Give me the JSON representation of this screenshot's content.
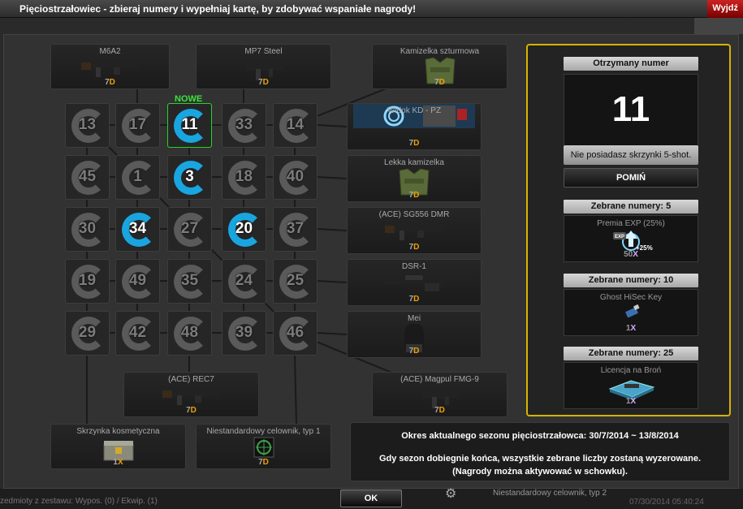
{
  "window": {
    "title": "Pięciostrzałowiec - zbieraj numery i wypełniaj kartę, by zdobywać wspaniałe nagrody!",
    "exit_label": "Wyjdź"
  },
  "prizes": {
    "top": [
      {
        "name": "M6A2",
        "qty": "7",
        "unit": "D",
        "icon": "rifle-icon"
      },
      {
        "name": "MP7 Steel",
        "qty": "7",
        "unit": "D",
        "icon": "smg-icon"
      },
      {
        "name": "Kamizelka szturmowa",
        "qty": "7",
        "unit": "D",
        "icon": "vest-icon"
      }
    ],
    "right": [
      {
        "name": "Widok KD - PZ",
        "qty": "7",
        "unit": "D",
        "icon": "scope-view-icon"
      },
      {
        "name": "Lekka kamizelka",
        "qty": "7",
        "unit": "D",
        "icon": "vest-icon"
      },
      {
        "name": "(ACE) SG556 DMR",
        "qty": "7",
        "unit": "D",
        "icon": "rifle-icon"
      },
      {
        "name": "DSR-1",
        "qty": "7",
        "unit": "D",
        "icon": "sniper-icon"
      },
      {
        "name": "Mei",
        "qty": "7",
        "unit": "D",
        "icon": "character-icon"
      }
    ],
    "bottom": [
      {
        "name": "(ACE) REC7",
        "qty": "7",
        "unit": "D",
        "icon": "rifle-icon"
      },
      {
        "name": "(ACE) Magpul FMG-9",
        "qty": "7",
        "unit": "D",
        "icon": "smg-icon"
      }
    ],
    "corner": [
      {
        "name": "Skrzynka kosmetyczna",
        "qty": "1",
        "unit": "X",
        "icon": "crate-icon"
      },
      {
        "name": "Niestandardowy celownik, typ 1",
        "qty": "7",
        "unit": "D",
        "icon": "crosshair-icon"
      }
    ]
  },
  "grid": {
    "newest_label": "NOWE",
    "rows": [
      [
        {
          "n": "13",
          "hit": false
        },
        {
          "n": "17",
          "hit": false
        },
        {
          "n": "11",
          "hit": true,
          "newest": true
        },
        {
          "n": "33",
          "hit": false
        },
        {
          "n": "14",
          "hit": false
        }
      ],
      [
        {
          "n": "45",
          "hit": false
        },
        {
          "n": "1",
          "hit": false
        },
        {
          "n": "3",
          "hit": true
        },
        {
          "n": "18",
          "hit": false
        },
        {
          "n": "40",
          "hit": false
        }
      ],
      [
        {
          "n": "30",
          "hit": false
        },
        {
          "n": "34",
          "hit": true
        },
        {
          "n": "27",
          "hit": false
        },
        {
          "n": "20",
          "hit": true
        },
        {
          "n": "37",
          "hit": false
        }
      ],
      [
        {
          "n": "19",
          "hit": false
        },
        {
          "n": "49",
          "hit": false
        },
        {
          "n": "35",
          "hit": false
        },
        {
          "n": "24",
          "hit": false
        },
        {
          "n": "25",
          "hit": false
        }
      ],
      [
        {
          "n": "29",
          "hit": false
        },
        {
          "n": "42",
          "hit": false
        },
        {
          "n": "48",
          "hit": false
        },
        {
          "n": "39",
          "hit": false
        },
        {
          "n": "46",
          "hit": false
        }
      ]
    ]
  },
  "info": {
    "line1": "Okres aktualnego sezonu pięciostrzałowca: 30/7/2014 ~ 13/8/2014",
    "line2": "Gdy sezon dobiegnie końca, wszystkie zebrane liczby zostaną wyzerowane.",
    "line3": "(Nagrody można aktywować w schowku)."
  },
  "panel": {
    "received_header": "Otrzymany numer",
    "received_number": "11",
    "no_box_button": "Nie posiadasz skrzynki 5-shot.",
    "skip_button": "POMIŃ",
    "rewards": [
      {
        "header": "Zebrane numery: 5",
        "name": "Premia EXP (25%)",
        "qty": "50",
        "unit": "X",
        "badge": "+25%",
        "icon": "exp-bonus-icon"
      },
      {
        "header": "Zebrane numery: 10",
        "name": "Ghost HiSec Key",
        "qty": "1",
        "unit": "X",
        "icon": "usb-key-icon"
      },
      {
        "header": "Zebrane numery: 25",
        "name": "Licencja na Broń",
        "qty": "1",
        "unit": "X",
        "icon": "license-icon"
      }
    ]
  },
  "footer": {
    "left_text": "zedmioty z zestawu: Wypos. (0) / Ekwip. (1)",
    "ok_button": "OK",
    "bg_item": "Niestandardowy celownik, typ 2",
    "bg_time": "07/30/2014  05:40:24"
  },
  "colors": {
    "hit": "#19a6e0",
    "newest": "#3fe03f",
    "panel_border": "#d8b200",
    "unit": "#f0a000"
  }
}
